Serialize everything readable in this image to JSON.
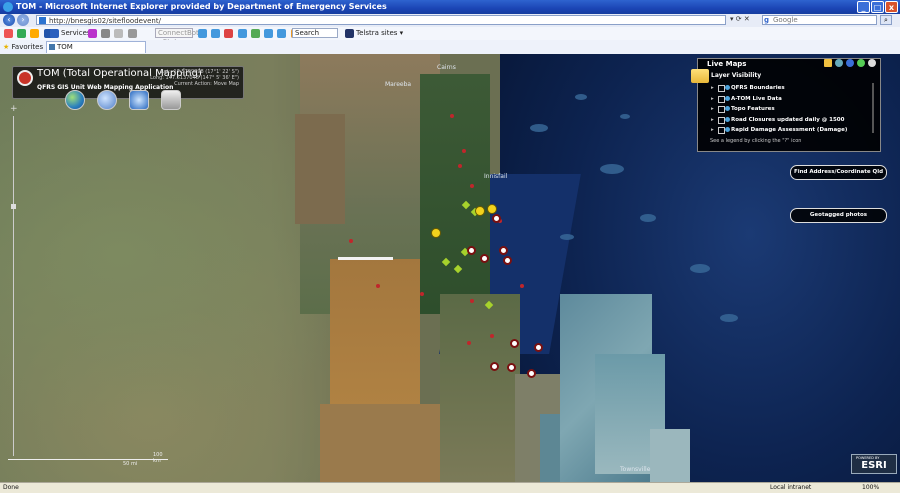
{
  "window": {
    "title": "TOM - Microsoft Internet Explorer provided by Department of Emergency Services",
    "controls": [
      "_",
      "□",
      "x"
    ]
  },
  "address_bar": {
    "url": "http://bnesgis02/sitefloodevent/",
    "search_placeholder": "Google",
    "search_icon": "search-icon"
  },
  "toolbar": {
    "services_label": "Services",
    "select_value": "ConnectBot - Status",
    "search_label": "Search",
    "telstra_label": "Telstra sites"
  },
  "favorites": {
    "favorites_label": "Favorites",
    "tab_label": "TOM"
  },
  "app": {
    "title": "TOM (Total Operational Mapping)",
    "subtitle": "QFRS GIS Unit Web Mapping Application",
    "coords_lat": "Lat: -17.5709898 (17°1' 22' S\")",
    "coords_long": "Long: 147.6137048 (147° 5' 36' E\")",
    "current_action": "Current Action: Move Map",
    "tool_icons": [
      "globe-icon",
      "compass-icon",
      "layers-icon",
      "print-icon"
    ]
  },
  "live_maps": {
    "header": "Live Maps",
    "layer_visibility": "Layer Visibility",
    "layers": [
      {
        "label": "QFRS Boundaries"
      },
      {
        "label": "A-TOM Live Data"
      },
      {
        "label": "Topo Features"
      },
      {
        "label": "Road Closures updated daily @ 1500"
      },
      {
        "label": "Rapid Damage Assessment (Damage)"
      }
    ],
    "legend_note": "See a legend by clicking the \"?\" icon"
  },
  "buttons": {
    "find_address": "Find Address/Coordinate Qld",
    "geotagged": "Geotagged photos"
  },
  "map_labels": {
    "cairns": "Cairns",
    "innisfail": "Innisfail",
    "mareeba": "Mareeba",
    "townsville": "Townsville",
    "scale_top": "100 km",
    "scale_bottom": "50 mi"
  },
  "esri": {
    "powered": "POWERED BY",
    "name": "ESRI"
  },
  "status": {
    "done": "Done",
    "zone": "Local intranet",
    "zoom": "100%"
  }
}
